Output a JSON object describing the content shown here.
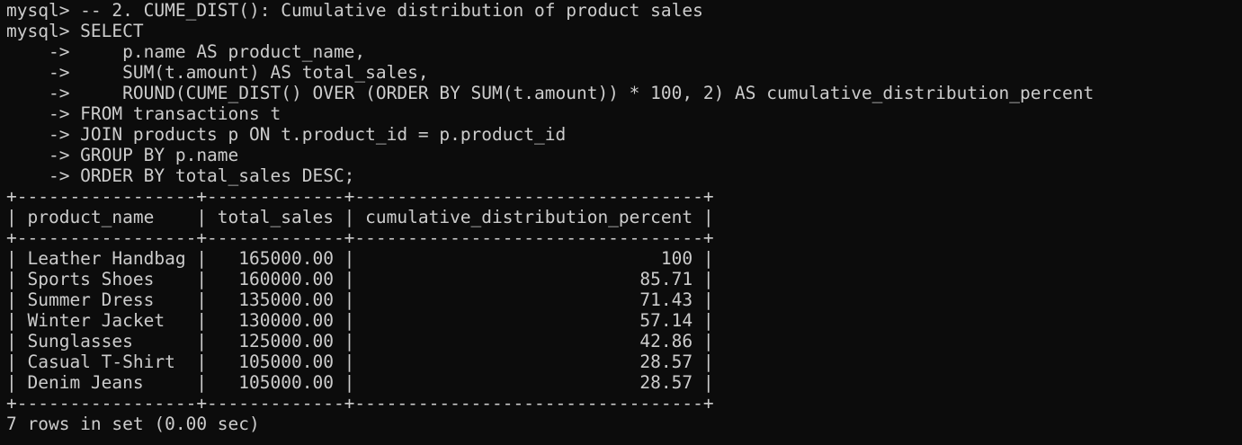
{
  "terminal": {
    "lines": [
      "mysql> -- 2. CUME_DIST(): Cumulative distribution of product sales",
      "mysql> SELECT",
      "    ->     p.name AS product_name,",
      "    ->     SUM(t.amount) AS total_sales,",
      "    ->     ROUND(CUME_DIST() OVER (ORDER BY SUM(t.amount)) * 100, 2) AS cumulative_distribution_percent",
      "    -> FROM transactions t",
      "    -> JOIN products p ON t.product_id = p.product_id",
      "    -> GROUP BY p.name",
      "    -> ORDER BY total_sales DESC;",
      "+-----------------+-------------+---------------------------------+",
      "| product_name    | total_sales | cumulative_distribution_percent |",
      "+-----------------+-------------+---------------------------------+",
      "| Leather Handbag |   165000.00 |                             100 |",
      "| Sports Shoes    |   160000.00 |                           85.71 |",
      "| Summer Dress    |   135000.00 |                           71.43 |",
      "| Winter Jacket   |   130000.00 |                           57.14 |",
      "| Sunglasses      |   125000.00 |                           42.86 |",
      "| Casual T-Shirt  |   105000.00 |                           28.57 |",
      "| Denim Jeans     |   105000.00 |                           28.57 |",
      "+-----------------+-------------+---------------------------------+",
      "7 rows in set (0.00 sec)"
    ]
  },
  "colors": {
    "background": "#0c0c0c",
    "foreground": "#cccccc"
  }
}
